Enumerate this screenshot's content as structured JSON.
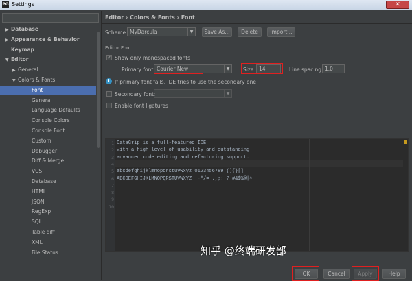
{
  "window": {
    "title": "Settings",
    "app_icon": "PG",
    "close_glyph": "✕"
  },
  "sidebar": {
    "items": [
      {
        "label": "Database",
        "arrow": "▶",
        "bold": true
      },
      {
        "label": "Appearance & Behavior",
        "arrow": "▶",
        "bold": true
      },
      {
        "label": "Keymap",
        "arrow": "",
        "bold": true
      },
      {
        "label": "Editor",
        "arrow": "▼",
        "bold": true
      },
      {
        "label": "General",
        "arrow": "▶",
        "bold": false
      },
      {
        "label": "Colors & Fonts",
        "arrow": "▼",
        "bold": false
      },
      {
        "label": "Font",
        "arrow": "",
        "bold": false,
        "selected": true
      },
      {
        "label": "General",
        "arrow": "",
        "bold": false
      },
      {
        "label": "Language Defaults",
        "arrow": "",
        "bold": false
      },
      {
        "label": "Console Colors",
        "arrow": "",
        "bold": false
      },
      {
        "label": "Console Font",
        "arrow": "",
        "bold": false
      },
      {
        "label": "Custom",
        "arrow": "",
        "bold": false
      },
      {
        "label": "Debugger",
        "arrow": "",
        "bold": false
      },
      {
        "label": "Diff & Merge",
        "arrow": "",
        "bold": false
      },
      {
        "label": "VCS",
        "arrow": "",
        "bold": false
      },
      {
        "label": "Database",
        "arrow": "",
        "bold": false
      },
      {
        "label": "HTML",
        "arrow": "",
        "bold": false
      },
      {
        "label": "JSON",
        "arrow": "",
        "bold": false
      },
      {
        "label": "RegExp",
        "arrow": "",
        "bold": false
      },
      {
        "label": "SQL",
        "arrow": "",
        "bold": false
      },
      {
        "label": "Table diff",
        "arrow": "",
        "bold": false
      },
      {
        "label": "XML",
        "arrow": "",
        "bold": false
      },
      {
        "label": "File Status",
        "arrow": "",
        "bold": false
      }
    ]
  },
  "breadcrumb": "Editor › Colors & Fonts › Font",
  "scheme": {
    "label": "Scheme:",
    "value": "MyDarcula",
    "save_as": "Save As...",
    "delete": "Delete",
    "import": "Import..."
  },
  "editor_font": {
    "section_title": "Editor Font",
    "show_monospaced": "Show only monospaced fonts",
    "primary_font_label": "Primary font:",
    "primary_font_value": "Courier New",
    "size_label": "Size:",
    "size_value": "14",
    "line_spacing_label": "Line spacing:",
    "line_spacing_value": "1.0",
    "info_text": "If primary font fails, IDE tries to use the secondary one",
    "secondary_font_label": "Secondary font:",
    "ligatures": "Enable font ligatures"
  },
  "preview": {
    "line_numbers": [
      "1",
      "2",
      "3",
      "4",
      "5",
      "6",
      "7",
      "8",
      "9",
      "10"
    ],
    "lines": [
      "DataGrip is a full-featured IDE",
      "with a high level of usability and outstanding",
      "advanced code editing and refactoring support.",
      "",
      "abcdefghijklmnopqrstuvwxyz 0123456789 (){}[]",
      "ABCDEFGHIJKLMNOPQRSTUVWXYZ +-*/= .,;:!? #&$%@|^",
      "",
      "",
      "",
      ""
    ]
  },
  "footer": {
    "ok": "OK",
    "cancel": "Cancel",
    "apply": "Apply",
    "help": "Help"
  },
  "watermark": "知乎 @终端研发部"
}
